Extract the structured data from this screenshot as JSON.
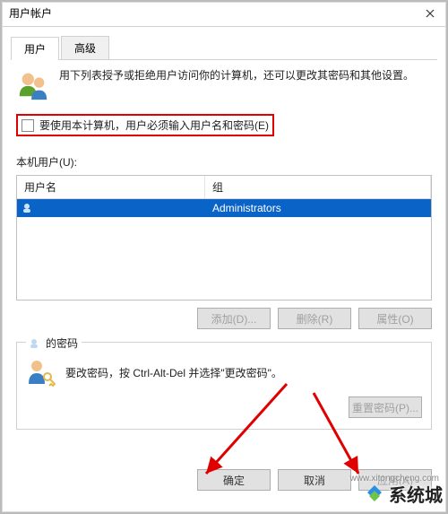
{
  "window": {
    "title": "用户帐户"
  },
  "tabs": {
    "user": "用户",
    "advanced": "高级"
  },
  "intro": {
    "text": "用下列表授予或拒绝用户访问你的计算机，还可以更改其密码和其他设置。"
  },
  "checkbox": {
    "label": "要使用本计算机，用户必须输入用户名和密码(E)"
  },
  "userlist": {
    "caption": "本机用户(U):",
    "col_user": "用户名",
    "col_group": "组",
    "rows": [
      {
        "user": "",
        "group": "Administrators"
      }
    ]
  },
  "buttons": {
    "add": "添加(D)...",
    "delete": "删除(R)",
    "properties": "属性(O)",
    "reset_pwd": "重置密码(P)...",
    "ok": "确定",
    "cancel": "取消",
    "apply": "应用(A)"
  },
  "password": {
    "legend_suffix": "的密码",
    "hint": "要改密码，按 Ctrl-Alt-Del 并选择\"更改密码\"。"
  },
  "watermark": {
    "text": "系统城",
    "url": "www.xitongcheng.com"
  }
}
